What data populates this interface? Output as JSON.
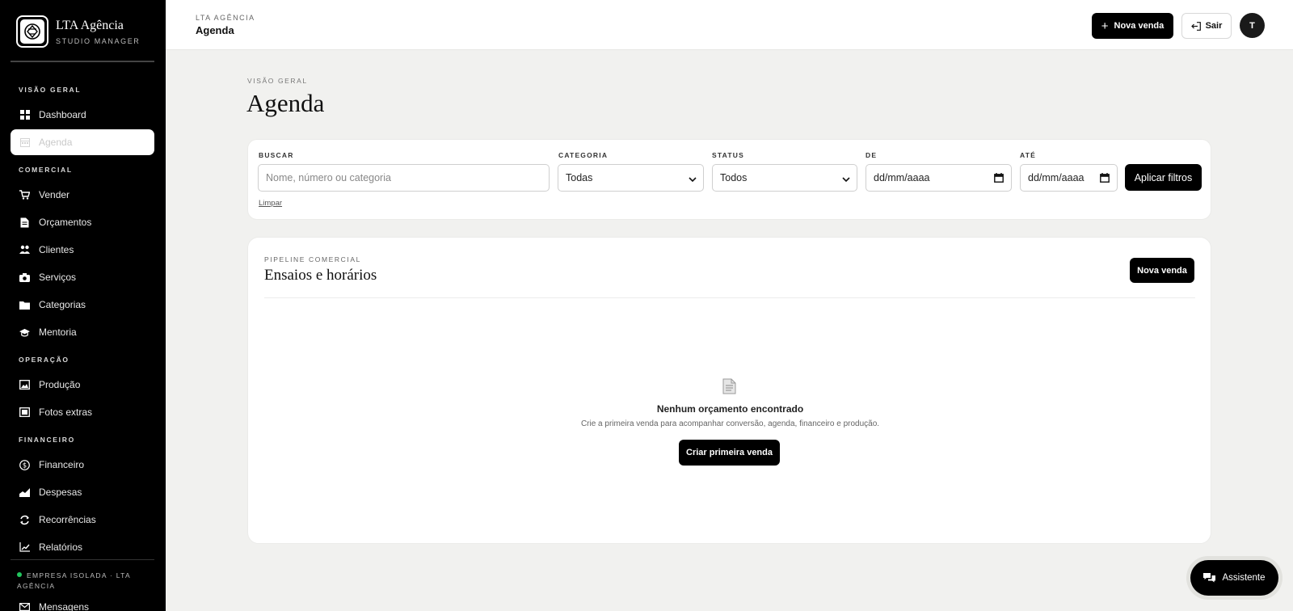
{
  "brand": {
    "name": "LTA Agência",
    "subtitle": "STUDIO MANAGER"
  },
  "sidebar": {
    "sections": [
      {
        "title": "VISÃO GERAL",
        "items": [
          {
            "label": "Dashboard",
            "icon": "grid-icon"
          },
          {
            "label": "Agenda",
            "icon": "calendar-icon",
            "active": true
          }
        ]
      },
      {
        "title": "COMERCIAL",
        "items": [
          {
            "label": "Vender",
            "icon": "cart-icon"
          },
          {
            "label": "Orçamentos",
            "icon": "document-icon"
          },
          {
            "label": "Clientes",
            "icon": "users-icon"
          },
          {
            "label": "Serviços",
            "icon": "camera-icon"
          },
          {
            "label": "Categorias",
            "icon": "folder-icon"
          },
          {
            "label": "Mentoria",
            "icon": "graduation-cap-icon"
          }
        ]
      },
      {
        "title": "OPERAÇÃO",
        "items": [
          {
            "label": "Produção",
            "icon": "image-icon"
          },
          {
            "label": "Fotos extras",
            "icon": "photos-icon"
          }
        ]
      },
      {
        "title": "FINANCEIRO",
        "items": [
          {
            "label": "Financeiro",
            "icon": "dollar-icon"
          },
          {
            "label": "Despesas",
            "icon": "area-chart-icon"
          },
          {
            "label": "Recorrências",
            "icon": "refresh-icon"
          },
          {
            "label": "Relatórios",
            "icon": "line-chart-icon"
          }
        ]
      }
    ],
    "footer": "EMPRESA ISOLADA · LTA AGÊNCIA",
    "cut_item": "Mensagens"
  },
  "topbar": {
    "org": "LTA AGÊNCIA",
    "page": "Agenda",
    "new_sale": "Nova venda",
    "logout": "Sair",
    "avatar_initial": "T"
  },
  "page": {
    "kicker": "VISÃO GERAL",
    "title": "Agenda"
  },
  "filters": {
    "search_label": "BUSCAR",
    "search_placeholder": "Nome, número ou categoria",
    "category_label": "CATEGORIA",
    "category_value": "Todas",
    "status_label": "STATUS",
    "status_value": "Todos",
    "from_label": "DE",
    "from_placeholder": "dd/mm/aaaa",
    "to_label": "ATÉ",
    "to_placeholder": "dd/mm/aaaa",
    "apply": "Aplicar filtros",
    "clear": "Limpar"
  },
  "pipeline": {
    "kicker": "PIPELINE COMERCIAL",
    "title": "Ensaios e horários",
    "new_sale": "Nova venda",
    "empty_title": "Nenhum orçamento encontrado",
    "empty_subtitle": "Crie a primeira venda para acompanhar conversão, agenda, financeiro e produção.",
    "empty_button": "Criar primeira venda"
  },
  "assistant": {
    "label": "Assistente"
  }
}
